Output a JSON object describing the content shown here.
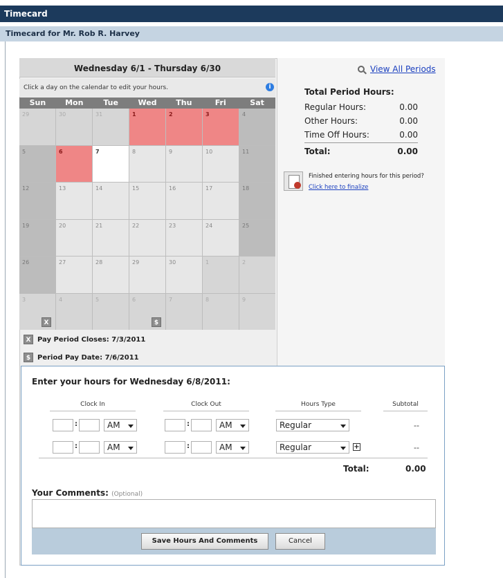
{
  "app": {
    "title": "Timecard"
  },
  "page": {
    "subtitle": "Timecard for Mr. Rob R. Harvey"
  },
  "calendar": {
    "period_title": "Wednesday 6/1 - Thursday 6/30",
    "hint": "Click a day on the calendar to edit your hours.",
    "info_icon": "i",
    "days_of_week": [
      "Sun",
      "Mon",
      "Tue",
      "Wed",
      "Thu",
      "Fri",
      "Sat"
    ],
    "weeks": [
      [
        "29",
        "30",
        "31",
        "1",
        "2",
        "3",
        "4"
      ],
      [
        "5",
        "6",
        "7",
        "8",
        "9",
        "10",
        "11"
      ],
      [
        "12",
        "13",
        "14",
        "15",
        "16",
        "17",
        "18"
      ],
      [
        "19",
        "20",
        "21",
        "22",
        "23",
        "24",
        "25"
      ],
      [
        "26",
        "27",
        "28",
        "29",
        "30",
        "1",
        "2"
      ],
      [
        "3",
        "4",
        "5",
        "6",
        "7",
        "8",
        "9"
      ]
    ],
    "pay_close_badge": "X",
    "pay_date_badge": "$",
    "legend_close": "Pay Period Closes: 7/3/2011",
    "legend_pay": "Period Pay Date: 7/6/2011"
  },
  "summary": {
    "view_all": "View All Periods",
    "title": "Total Period Hours:",
    "regular_label": "Regular Hours:",
    "regular_value": "0.00",
    "other_label": "Other Hours:",
    "other_value": "0.00",
    "timeoff_label": "Time Off Hours:",
    "timeoff_value": "0.00",
    "total_label": "Total:",
    "total_value": "0.00",
    "finalize_question": "Finished entering hours for this period?",
    "finalize_link": "Click here to finalize"
  },
  "entry": {
    "title": "Enter your hours for Wednesday 6/8/2011:",
    "col_clock_in": "Clock In",
    "col_clock_out": "Clock Out",
    "col_hours_type": "Hours Type",
    "col_subtotal": "Subtotal",
    "row1_in_ampm": "AM",
    "row1_out_ampm": "AM",
    "row1_type": "Regular",
    "row1_subtotal": "--",
    "row2_in_ampm": "AM",
    "row2_out_ampm": "AM",
    "row2_type": "Regular",
    "row2_subtotal": "--",
    "total_label": "Total:",
    "total_value": "0.00",
    "comments_label": "Your Comments:",
    "comments_optional": "(Optional)",
    "save_button": "Save Hours And Comments",
    "cancel_button": "Cancel"
  }
}
